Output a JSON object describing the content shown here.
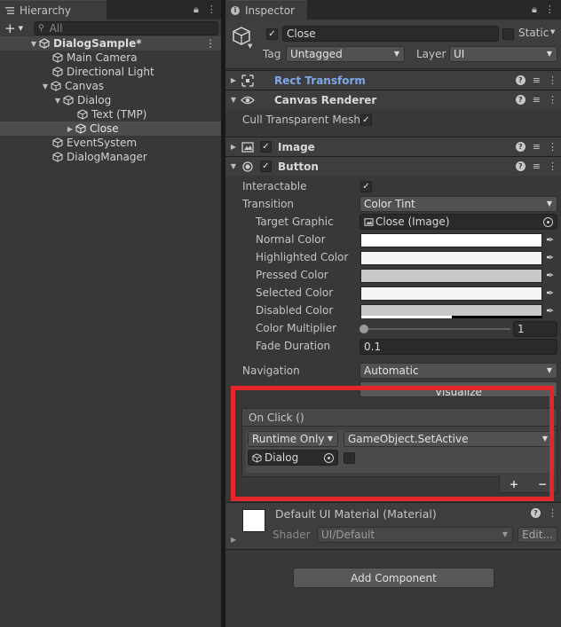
{
  "hierarchy": {
    "tab_title": "Hierarchy",
    "search_placeholder": "All",
    "add_label": "+",
    "tree": [
      {
        "label": "DialogSample*"
      },
      {
        "label": "Main Camera"
      },
      {
        "label": "Directional Light"
      },
      {
        "label": "Canvas"
      },
      {
        "label": "Dialog"
      },
      {
        "label": "Text (TMP)"
      },
      {
        "label": "Close"
      },
      {
        "label": "EventSystem"
      },
      {
        "label": "DialogManager"
      }
    ]
  },
  "inspector": {
    "tab_title": "Inspector",
    "object": {
      "name": "Close",
      "static_label": "Static",
      "tag_label": "Tag",
      "tag_value": "Untagged",
      "layer_label": "Layer",
      "layer_value": "UI"
    },
    "components": {
      "rect_transform": "Rect Transform",
      "canvas_renderer": "Canvas Renderer",
      "cull_label": "Cull Transparent Mesh",
      "image": "Image",
      "button": "Button"
    },
    "button": {
      "interactable_label": "Interactable",
      "transition_label": "Transition",
      "transition_value": "Color Tint",
      "target_graphic_label": "Target Graphic",
      "target_graphic_value": "Close (Image)",
      "normal_color_label": "Normal Color",
      "highlighted_color_label": "Highlighted Color",
      "pressed_color_label": "Pressed Color",
      "selected_color_label": "Selected Color",
      "disabled_color_label": "Disabled Color",
      "color_multiplier_label": "Color Multiplier",
      "color_multiplier_value": "1",
      "fade_duration_label": "Fade Duration",
      "fade_duration_value": "0.1",
      "navigation_label": "Navigation",
      "navigation_value": "Automatic",
      "visualize_label": "Visualize"
    },
    "on_click": {
      "header": "On Click ()",
      "runtime_value": "Runtime Only",
      "function_value": "GameObject.SetActive",
      "target_value": "Dialog",
      "add_label": "+",
      "remove_label": "−"
    },
    "material": {
      "name": "Default UI Material (Material)",
      "shader_label": "Shader",
      "shader_value": "UI/Default",
      "edit_label": "Edit..."
    },
    "add_component_label": "Add Component"
  },
  "colors": {
    "highlight_box": "#e3262c",
    "link_blue": "#7ea7e8",
    "normal": "#ffffff",
    "highlighted": "#f5f5f5",
    "pressed": "#c8c8c8",
    "selected": "#f5f5f5",
    "disabled": "#c8c8c8"
  }
}
